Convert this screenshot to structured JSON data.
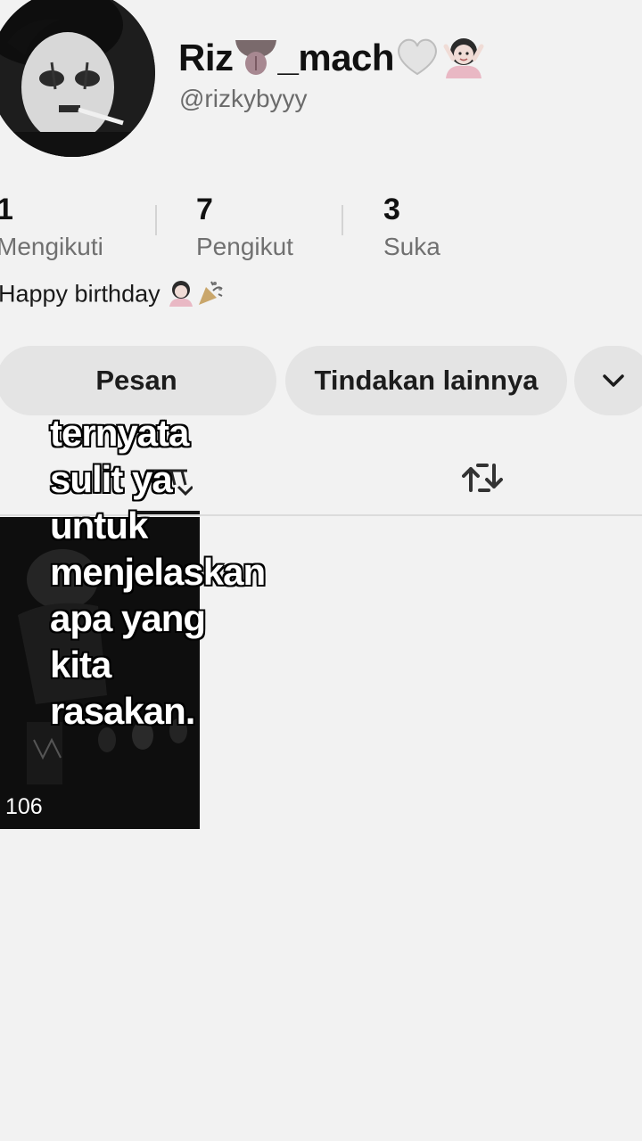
{
  "profile": {
    "display_name_part1": "Riz",
    "display_name_part2": "_mach",
    "username": "@rizkybyyy",
    "bio": "Happy birthday"
  },
  "stats": [
    {
      "value": "1",
      "label": "Mengikuti"
    },
    {
      "value": "7",
      "label": "Pengikut"
    },
    {
      "value": "3",
      "label": "Suka"
    }
  ],
  "buttons": {
    "message": "Pesan",
    "more_actions": "Tindakan lainnya"
  },
  "video": {
    "views": "106"
  },
  "overlay_caption": "ternyata\nsulit ya\nuntuk\nmenjelaskan\napa yang\nkita\nrasakan.",
  "icons": {
    "dropdown": "chevron-down-icon",
    "repost_tab": "repost-icon",
    "grid_tab": "grid-icon"
  },
  "colors": {
    "background": "#f2f2f2",
    "button": "#e4e4e4",
    "text_primary": "#161616",
    "text_secondary": "#707070"
  }
}
